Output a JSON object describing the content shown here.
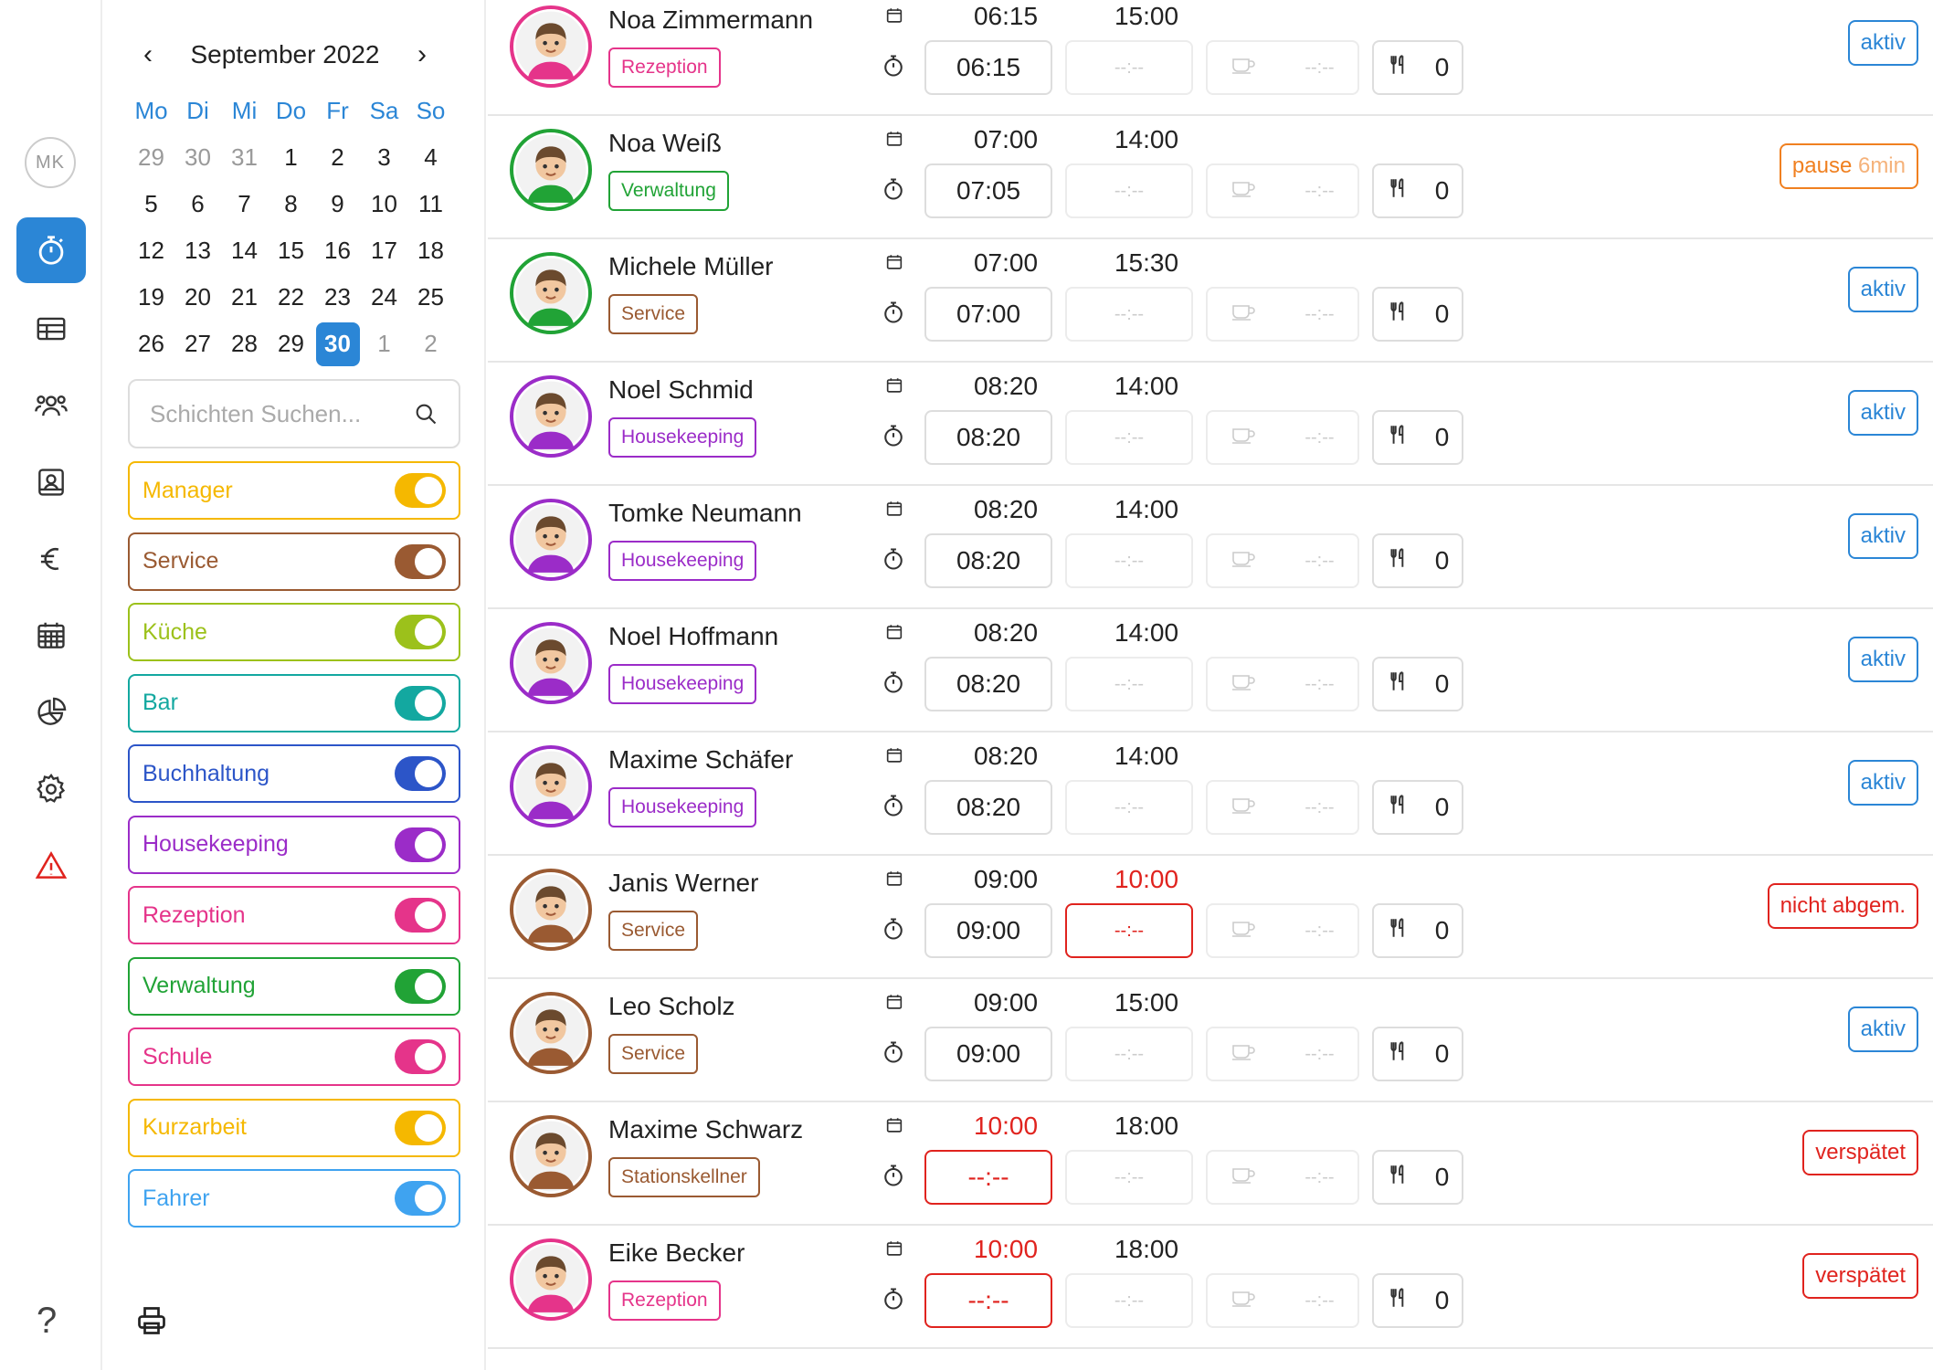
{
  "user_initials": "MK",
  "calendar": {
    "month_label": "September 2022",
    "weekdays": [
      "Mo",
      "Di",
      "Mi",
      "Do",
      "Fr",
      "Sa",
      "So"
    ],
    "days": [
      {
        "d": "29",
        "muted": true
      },
      {
        "d": "30",
        "muted": true
      },
      {
        "d": "31",
        "muted": true
      },
      {
        "d": "1"
      },
      {
        "d": "2"
      },
      {
        "d": "3"
      },
      {
        "d": "4"
      },
      {
        "d": "5"
      },
      {
        "d": "6"
      },
      {
        "d": "7"
      },
      {
        "d": "8"
      },
      {
        "d": "9"
      },
      {
        "d": "10"
      },
      {
        "d": "11"
      },
      {
        "d": "12"
      },
      {
        "d": "13"
      },
      {
        "d": "14"
      },
      {
        "d": "15"
      },
      {
        "d": "16"
      },
      {
        "d": "17"
      },
      {
        "d": "18"
      },
      {
        "d": "19"
      },
      {
        "d": "20"
      },
      {
        "d": "21"
      },
      {
        "d": "22"
      },
      {
        "d": "23"
      },
      {
        "d": "24"
      },
      {
        "d": "25"
      },
      {
        "d": "26"
      },
      {
        "d": "27"
      },
      {
        "d": "28"
      },
      {
        "d": "29"
      },
      {
        "d": "30",
        "selected": true
      },
      {
        "d": "1",
        "muted": true
      },
      {
        "d": "2",
        "muted": true
      }
    ]
  },
  "search": {
    "placeholder": "Schichten Suchen..."
  },
  "filters": [
    {
      "label": "Manager",
      "color": "#f5b800"
    },
    {
      "label": "Service",
      "color": "#9a5a32"
    },
    {
      "label": "Küche",
      "color": "#9cc11b"
    },
    {
      "label": "Bar",
      "color": "#13a8a0"
    },
    {
      "label": "Buchhaltung",
      "color": "#2c55c8"
    },
    {
      "label": "Housekeeping",
      "color": "#9b2cc8"
    },
    {
      "label": "Rezeption",
      "color": "#e5348a"
    },
    {
      "label": "Verwaltung",
      "color": "#21a336"
    },
    {
      "label": "Schule",
      "color": "#e5348a"
    },
    {
      "label": "Kurzarbeit",
      "color": "#f5b800"
    },
    {
      "label": "Fahrer",
      "color": "#3fa3f0"
    }
  ],
  "employees": [
    {
      "name": "Noa Zimmermann",
      "dept": "Rezeption",
      "dept_color": "#e5348a",
      "ring": "#e5348a",
      "planned_start": "06:15",
      "planned_end": "15:00",
      "clock_in": "06:15",
      "clock_out": "--:--",
      "break": "--:--",
      "meals": "0",
      "status": "aktiv",
      "status_color": "#2b86d6"
    },
    {
      "name": "Noa Weiß",
      "dept": "Verwaltung",
      "dept_color": "#21a336",
      "ring": "#21a336",
      "planned_start": "07:00",
      "planned_end": "14:00",
      "clock_in": "07:05",
      "clock_out": "--:--",
      "break": "--:--",
      "meals": "0",
      "status": "pause",
      "status_extra": "6min",
      "status_color": "#f08020"
    },
    {
      "name": "Michele Müller",
      "dept": "Service",
      "dept_color": "#9a5a32",
      "ring": "#21a336",
      "planned_start": "07:00",
      "planned_end": "15:30",
      "clock_in": "07:00",
      "clock_out": "--:--",
      "break": "--:--",
      "meals": "0",
      "status": "aktiv",
      "status_color": "#2b86d6"
    },
    {
      "name": "Noel Schmid",
      "dept": "Housekeeping",
      "dept_color": "#9b2cc8",
      "ring": "#9b2cc8",
      "planned_start": "08:20",
      "planned_end": "14:00",
      "clock_in": "08:20",
      "clock_out": "--:--",
      "break": "--:--",
      "meals": "0",
      "status": "aktiv",
      "status_color": "#2b86d6"
    },
    {
      "name": "Tomke Neumann",
      "dept": "Housekeeping",
      "dept_color": "#9b2cc8",
      "ring": "#9b2cc8",
      "planned_start": "08:20",
      "planned_end": "14:00",
      "clock_in": "08:20",
      "clock_out": "--:--",
      "break": "--:--",
      "meals": "0",
      "status": "aktiv",
      "status_color": "#2b86d6"
    },
    {
      "name": "Noel Hoffmann",
      "dept": "Housekeeping",
      "dept_color": "#9b2cc8",
      "ring": "#9b2cc8",
      "planned_start": "08:20",
      "planned_end": "14:00",
      "clock_in": "08:20",
      "clock_out": "--:--",
      "break": "--:--",
      "meals": "0",
      "status": "aktiv",
      "status_color": "#2b86d6"
    },
    {
      "name": "Maxime Schäfer",
      "dept": "Housekeeping",
      "dept_color": "#9b2cc8",
      "ring": "#9b2cc8",
      "planned_start": "08:20",
      "planned_end": "14:00",
      "clock_in": "08:20",
      "clock_out": "--:--",
      "break": "--:--",
      "meals": "0",
      "status": "aktiv",
      "status_color": "#2b86d6"
    },
    {
      "name": "Janis Werner",
      "dept": "Service",
      "dept_color": "#9a5a32",
      "ring": "#9a5a32",
      "planned_start": "09:00",
      "planned_end": "10:00",
      "end_red": true,
      "clock_in": "09:00",
      "clock_out": "--:--",
      "out_err": true,
      "break": "--:--",
      "meals": "0",
      "status": "nicht abgem.",
      "status_color": "#e0231e"
    },
    {
      "name": "Leo Scholz",
      "dept": "Service",
      "dept_color": "#9a5a32",
      "ring": "#9a5a32",
      "planned_start": "09:00",
      "planned_end": "15:00",
      "clock_in": "09:00",
      "clock_out": "--:--",
      "break": "--:--",
      "meals": "0",
      "status": "aktiv",
      "status_color": "#2b86d6"
    },
    {
      "name": "Maxime Schwarz",
      "dept": "Stationskellner",
      "dept_color": "#9a5a32",
      "ring": "#9a5a32",
      "planned_start": "10:00",
      "start_red": true,
      "planned_end": "18:00",
      "clock_in": "--:--",
      "in_err": true,
      "clock_out": "--:--",
      "break": "--:--",
      "meals": "0",
      "status": "verspätet",
      "status_color": "#e0231e"
    },
    {
      "name": "Eike Becker",
      "dept": "Rezeption",
      "dept_color": "#e5348a",
      "ring": "#e5348a",
      "planned_start": "10:00",
      "start_red": true,
      "planned_end": "18:00",
      "clock_in": "--:--",
      "in_err": true,
      "clock_out": "--:--",
      "break": "--:--",
      "meals": "0",
      "status": "verspätet",
      "status_color": "#e0231e"
    }
  ]
}
